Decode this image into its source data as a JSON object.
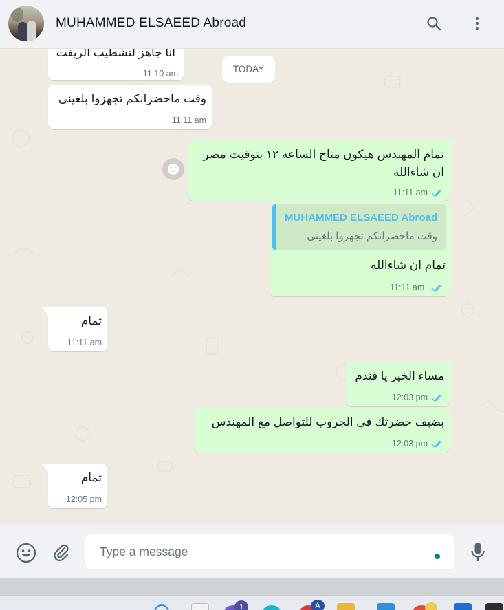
{
  "header": {
    "contact_name": "MUHAMMED ELSAEED Abroad",
    "avatar_icon": "contact-photo",
    "search_icon": "search-icon",
    "menu_icon": "more-vertical-icon"
  },
  "chat": {
    "date_divider": "TODAY",
    "messages": [
      {
        "direction": "in",
        "text": "انا جاهز لتشطيب الريفت",
        "time": "11:10 am"
      },
      {
        "direction": "in",
        "text": "وقت ماحضرانكم تجهزوا بلغينى",
        "time": "11:11 am"
      },
      {
        "direction": "out",
        "text_line1": "تمام المهندس هيكون متاح الساعه ١٢ بتوقيت مصر",
        "text_line2": "ان شاءالله",
        "time": "11:11 am",
        "status": "read"
      },
      {
        "direction": "out",
        "quote_author": "MUHAMMED ELSAEED Abroad",
        "quote_text": "وقت ماحضرانكم تجهزوا بلغينى",
        "text": "تمام ان شاءالله",
        "time": "11:11 am",
        "status": "read"
      },
      {
        "direction": "in",
        "text": "تمام",
        "time": "11:11 am"
      },
      {
        "direction": "out",
        "text": "مساء الخير يا فندم",
        "time": "12:03 pm",
        "status": "read"
      },
      {
        "direction": "out",
        "text": "بضيف حضرتك في الجروب للتواصل مع المهندس",
        "time": "12:03 pm",
        "status": "read"
      },
      {
        "direction": "in",
        "text": "تمام",
        "time": "12:05 pm"
      }
    ]
  },
  "composer": {
    "placeholder": "Type a message",
    "emoji_icon": "emoji-icon",
    "attach_icon": "paperclip-icon",
    "mic_icon": "microphone-icon"
  },
  "taskbar": {
    "badge_count": "1",
    "badge_letter": "A"
  },
  "colors": {
    "chat_background": "#efeae2",
    "incoming_bubble": "#ffffff",
    "outgoing_bubble": "#d9fdd3",
    "read_ticks": "#53bdeb",
    "quote_author": "#53bdeb",
    "header_background": "#f0f2f5"
  }
}
